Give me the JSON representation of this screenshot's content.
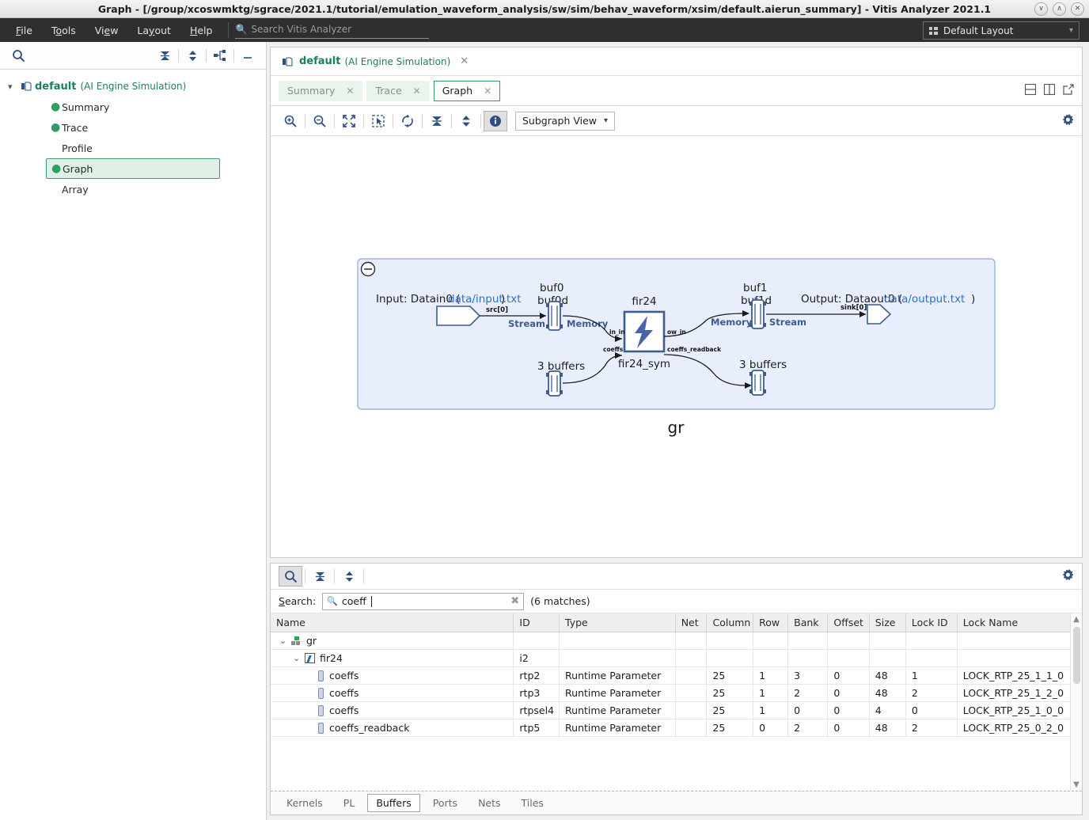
{
  "window": {
    "title": "Graph - [/group/xcoswmktg/sgrace/2021.1/tutorial/emulation_waveform_analysis/sw/sim/behav_waveform/xsim/default.aierun_summary] - Vitis Analyzer 2021.1",
    "minimize": "∨",
    "maximize": "∧",
    "close": "✕"
  },
  "menubar": {
    "items": [
      {
        "label": "File",
        "accel": "F"
      },
      {
        "label": "Tools",
        "accel": "T"
      },
      {
        "label": "View",
        "accel": "V"
      },
      {
        "label": "Layout",
        "accel": "y"
      },
      {
        "label": "Help",
        "accel": "H"
      }
    ],
    "search_placeholder": "Search Vitis Analyzer",
    "search_value": "",
    "layout_label": "Default Layout"
  },
  "sidebar": {
    "toolbar_icons": [
      "collapse-all-icon",
      "expand-collapse-icon",
      "hierarchy-icon",
      "minimize-icon"
    ],
    "search_icon": "search-icon",
    "root": {
      "name": "default",
      "subtitle": "(AI Engine Simulation)"
    },
    "items": [
      {
        "label": "Summary",
        "has_bullet": true,
        "selected": false
      },
      {
        "label": "Trace",
        "has_bullet": true,
        "selected": false
      },
      {
        "label": "Profile",
        "has_bullet": false,
        "selected": false
      },
      {
        "label": "Graph",
        "has_bullet": true,
        "selected": true
      },
      {
        "label": "Array",
        "has_bullet": false,
        "selected": false
      }
    ]
  },
  "editor": {
    "doc_tab": {
      "title": "default",
      "subtitle": "(AI Engine Simulation)",
      "close": "✕"
    },
    "tabs": [
      {
        "label": "Summary",
        "active": false
      },
      {
        "label": "Trace",
        "active": false
      },
      {
        "label": "Graph",
        "active": true
      }
    ],
    "layout_icons": [
      "split-horizontal-icon",
      "split-vertical-icon",
      "open-external-icon"
    ],
    "toolbar": {
      "icons": [
        "zoom-in-icon",
        "zoom-out-icon",
        "zoom-fit-icon",
        "zoom-select-icon",
        "refresh-icon",
        "collapse-all-icon",
        "expand-all-icon",
        "info-icon"
      ],
      "view_select": "Subgraph View",
      "settings_icon": "gear-icon"
    }
  },
  "graph": {
    "container_label": "gr",
    "collapse_icon": "collapse-circle-icon",
    "input_label_prefix": "Input: Datain0 (",
    "input_file": "data/input.txt",
    "input_label_suffix": ")",
    "output_label_prefix": "Output: Dataout0 (",
    "output_file": "data/output.txt",
    "output_label_suffix": ")",
    "src_port": "src[0]",
    "sink_port": "sink[0]",
    "buf0": "buf0",
    "buf0d": "buf0d",
    "buf1": "buf1",
    "buf1d": "buf1d",
    "stream_left": "Stream",
    "memory_left": "Memory",
    "memory_right": "Memory",
    "stream_right": "Stream",
    "buffers_left": "3 buffers",
    "buffers_right": "3 buffers",
    "kernel_name": "fir24",
    "kernel_sub": "fir24_sym",
    "port_in1": "in_in",
    "port_in2": "coeffs",
    "port_out1": "ow_in",
    "port_out2": "coeffs_readback"
  },
  "bottom": {
    "toolbar_icons": [
      "search-toggle-icon",
      "collapse-all-icon",
      "expand-all-icon"
    ],
    "settings_icon": "gear-icon",
    "search_label": "Search:",
    "search_value": "coeff",
    "search_placeholder": "",
    "matches": "(6 matches)",
    "columns": [
      "Name",
      "ID",
      "Type",
      "Net",
      "Column",
      "Row",
      "Bank",
      "Offset",
      "Size",
      "Lock ID",
      "Lock Name"
    ],
    "rows": [
      {
        "indent": 0,
        "icon": "graph-icon",
        "chevron": "⌄",
        "name": "gr",
        "id": "",
        "type": "",
        "net": "",
        "column": "",
        "row": "",
        "bank": "",
        "offset": "",
        "size": "",
        "lock_id": "",
        "lock_name": ""
      },
      {
        "indent": 1,
        "icon": "kernel-icon",
        "chevron": "⌄",
        "name": "fir24",
        "id": "i2",
        "type": "",
        "net": "",
        "column": "",
        "row": "",
        "bank": "",
        "offset": "",
        "size": "",
        "lock_id": "",
        "lock_name": ""
      },
      {
        "indent": 2,
        "icon": "buffer-icon",
        "chevron": "",
        "name": "coeffs",
        "id": "rtp2",
        "type": "Runtime Parameter",
        "net": "",
        "column": "25",
        "row": "1",
        "bank": "3",
        "offset": "0",
        "size": "48",
        "lock_id": "1",
        "lock_name": "LOCK_RTP_25_1_1_0"
      },
      {
        "indent": 2,
        "icon": "buffer-icon",
        "chevron": "",
        "name": "coeffs",
        "id": "rtp3",
        "type": "Runtime Parameter",
        "net": "",
        "column": "25",
        "row": "1",
        "bank": "2",
        "offset": "0",
        "size": "48",
        "lock_id": "2",
        "lock_name": "LOCK_RTP_25_1_2_0"
      },
      {
        "indent": 2,
        "icon": "buffer-icon",
        "chevron": "",
        "name": "coeffs",
        "id": "rtpsel4",
        "type": "Runtime Parameter",
        "net": "",
        "column": "25",
        "row": "1",
        "bank": "0",
        "offset": "0",
        "size": "4",
        "lock_id": "0",
        "lock_name": "LOCK_RTP_25_1_0_0"
      },
      {
        "indent": 2,
        "icon": "buffer-icon",
        "chevron": "",
        "name": "coeffs_readback",
        "id": "rtp5",
        "type": "Runtime Parameter",
        "net": "",
        "column": "25",
        "row": "0",
        "bank": "2",
        "offset": "0",
        "size": "48",
        "lock_id": "2",
        "lock_name": "LOCK_RTP_25_0_2_0"
      }
    ],
    "tabs": [
      {
        "label": "Kernels",
        "active": false
      },
      {
        "label": "PL",
        "active": false
      },
      {
        "label": "Buffers",
        "active": true
      },
      {
        "label": "Ports",
        "active": false
      },
      {
        "label": "Nets",
        "active": false
      },
      {
        "label": "Tiles",
        "active": false
      }
    ]
  },
  "colors": {
    "accent_green": "#1b7f5a",
    "accent_blue": "#35527f",
    "graph_fill": "#e8eefb",
    "graph_border": "#9fb3d9",
    "link_blue": "#2d6fd1"
  }
}
